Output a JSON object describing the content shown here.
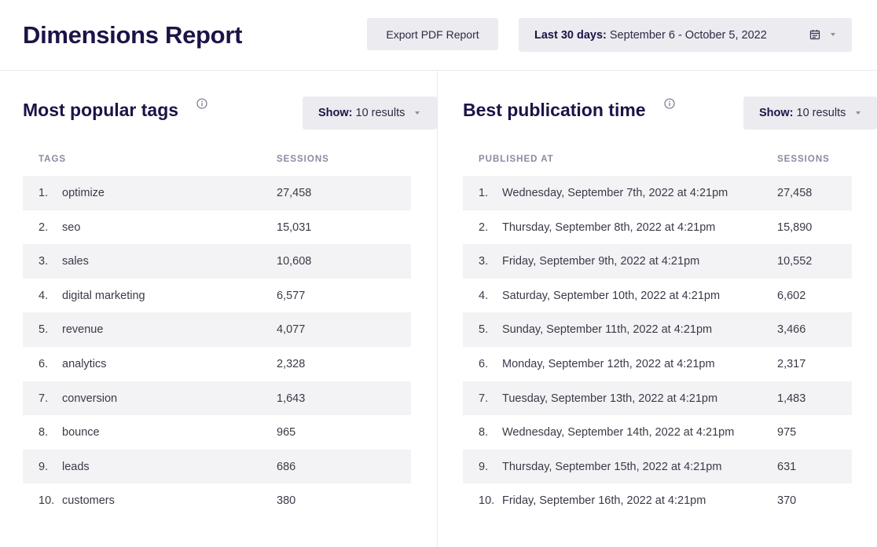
{
  "header": {
    "title": "Dimensions Report",
    "export_label": "Export PDF Report",
    "date_prefix": "Last 30 days:",
    "date_range": "September 6 - October 5, 2022"
  },
  "left": {
    "title": "Most popular tags",
    "show_prefix": "Show:",
    "show_value": "10 results",
    "col_label": "TAGS",
    "col_value": "SESSIONS",
    "rows": [
      {
        "n": "1.",
        "label": "optimize",
        "value": "27,458"
      },
      {
        "n": "2.",
        "label": "seo",
        "value": "15,031"
      },
      {
        "n": "3.",
        "label": "sales",
        "value": "10,608"
      },
      {
        "n": "4.",
        "label": "digital marketing",
        "value": "6,577"
      },
      {
        "n": "5.",
        "label": "revenue",
        "value": "4,077"
      },
      {
        "n": "6.",
        "label": "analytics",
        "value": "2,328"
      },
      {
        "n": "7.",
        "label": "conversion",
        "value": "1,643"
      },
      {
        "n": "8.",
        "label": "bounce",
        "value": "965"
      },
      {
        "n": "9.",
        "label": "leads",
        "value": "686"
      },
      {
        "n": "10.",
        "label": "customers",
        "value": "380"
      }
    ]
  },
  "right": {
    "title": "Best publication time",
    "show_prefix": "Show:",
    "show_value": "10 results",
    "col_label": "PUBLISHED AT",
    "col_value": "SESSIONS",
    "rows": [
      {
        "n": "1.",
        "label": "Wednesday, September 7th, 2022 at 4:21pm",
        "value": "27,458"
      },
      {
        "n": "2.",
        "label": "Thursday, September 8th, 2022 at 4:21pm",
        "value": "15,890"
      },
      {
        "n": "3.",
        "label": "Friday, September 9th, 2022 at 4:21pm",
        "value": "10,552"
      },
      {
        "n": "4.",
        "label": "Saturday, September 10th, 2022 at 4:21pm",
        "value": "6,602"
      },
      {
        "n": "5.",
        "label": "Sunday, September 11th, 2022 at 4:21pm",
        "value": "3,466"
      },
      {
        "n": "6.",
        "label": "Monday, September 12th, 2022 at 4:21pm",
        "value": "2,317"
      },
      {
        "n": "7.",
        "label": "Tuesday, September 13th, 2022 at 4:21pm",
        "value": "1,483"
      },
      {
        "n": "8.",
        "label": "Wednesday, September 14th, 2022 at 4:21pm",
        "value": "975"
      },
      {
        "n": "9.",
        "label": "Thursday, September 15th, 2022 at 4:21pm",
        "value": "631"
      },
      {
        "n": "10.",
        "label": "Friday, September 16th, 2022 at 4:21pm",
        "value": "370"
      }
    ]
  },
  "icons": {
    "info": "info-icon",
    "calendar": "calendar-icon",
    "caret": "chevron-down-icon"
  },
  "colors": {
    "title": "#1b1446",
    "button_bg": "#ebebf0",
    "row_shade": "#f3f3f6",
    "column_header": "#8a8aa0"
  }
}
